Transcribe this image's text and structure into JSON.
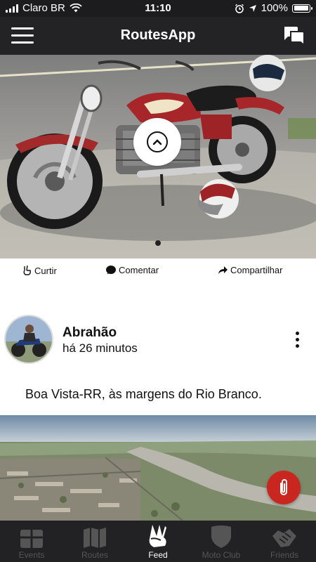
{
  "status_bar": {
    "carrier": "Claro BR",
    "time": "11:10",
    "battery": "100%",
    "battery_level": 1.0
  },
  "navbar": {
    "title": "RoutesApp",
    "menu_icon": "hamburger-icon",
    "chat_icon": "chat-bubbles-icon"
  },
  "hero": {
    "description_icon": "chevron-up-icon",
    "pager_dots": 1,
    "pager_active": 1
  },
  "actions": {
    "like": "Curtir",
    "comment": "Comentar",
    "share": "Compartilhar"
  },
  "post": {
    "author": "Abrahão",
    "time_ago": "há 26 minutos",
    "caption": "Boa Vista-RR, às margens do Rio Branco."
  },
  "tabs": [
    {
      "label": "Events",
      "icon": "calendar-icon",
      "active": false
    },
    {
      "label": "Routes",
      "icon": "map-icon",
      "active": false
    },
    {
      "label": "Feed",
      "icon": "victory-hand-icon",
      "active": true
    },
    {
      "label": "Moto Club",
      "icon": "shield-icon",
      "active": false
    },
    {
      "label": "Friends",
      "icon": "handshake-icon",
      "active": false
    }
  ],
  "colors": {
    "bar_dark": "#232326",
    "tab_bar": "#222225",
    "fab_red": "#c8261f",
    "active_tab": "#ffffff",
    "inactive_tab": "#555555"
  }
}
